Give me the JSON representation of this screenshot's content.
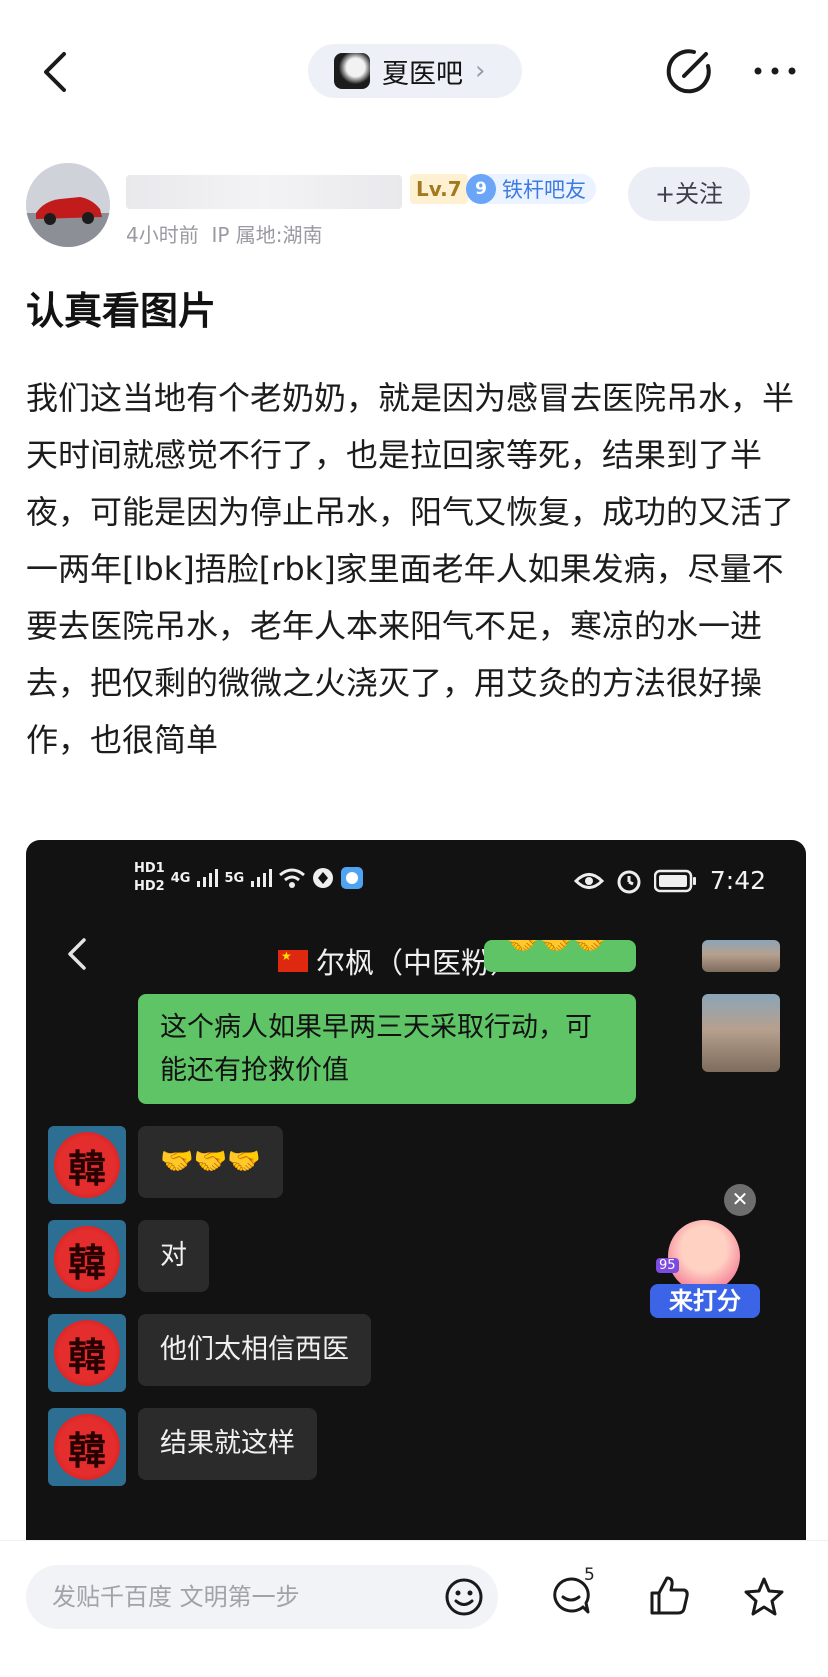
{
  "nav": {
    "forum_name": "夏医吧",
    "forum_chevron": "›"
  },
  "author": {
    "level": "Lv.7",
    "fan_level": "9",
    "fan_title": "铁杆吧友",
    "time": "4小时前",
    "ip_location": "IP 属地:湖南",
    "follow_label": "+关注"
  },
  "post": {
    "title": "认真看图片",
    "body": "我们这当地有个老奶奶，就是因为感冒去医院吊水，半天时间就感觉不行了，也是拉回家等死，结果到了半夜，可能是因为停止吊水，阳气又恢复，成功的又活了一两年[lbk]捂脸[rbk]家里面老年人如果发病，尽量不要去医院吊水，老年人本来阳气不足，寒凉的水一进去，把仅剩的微微之火浇灭了，用艾灸的方法很好操作，也很简单"
  },
  "screenshot": {
    "status_time": "7:42",
    "status_hd1": "HD1",
    "status_hd2": "HD2",
    "status_net1": "4G",
    "status_net2": "5G",
    "chat_title": "尔枫（中医粉）",
    "avatar_char": "韓",
    "messages": [
      {
        "from": "self",
        "text": "🤝🤝🤝"
      },
      {
        "from": "self",
        "text": "这个病人如果早两三天采取行动，可能还有抢救价值"
      },
      {
        "from": "other",
        "text": "🤝🤝🤝"
      },
      {
        "from": "other",
        "text": "对"
      },
      {
        "from": "other",
        "text": "他们太相信西医"
      },
      {
        "from": "other",
        "text": "结果就这样"
      }
    ]
  },
  "overlay": {
    "close": "✕",
    "rate_label": "来打分",
    "rate_score": "95"
  },
  "bottom": {
    "reply_placeholder": "发贴千百度 文明第一步",
    "comment_count": "5"
  },
  "colors": {
    "accent_blue": "#3e7be0",
    "chat_green": "#5ec466",
    "chat_bg": "#121212"
  }
}
